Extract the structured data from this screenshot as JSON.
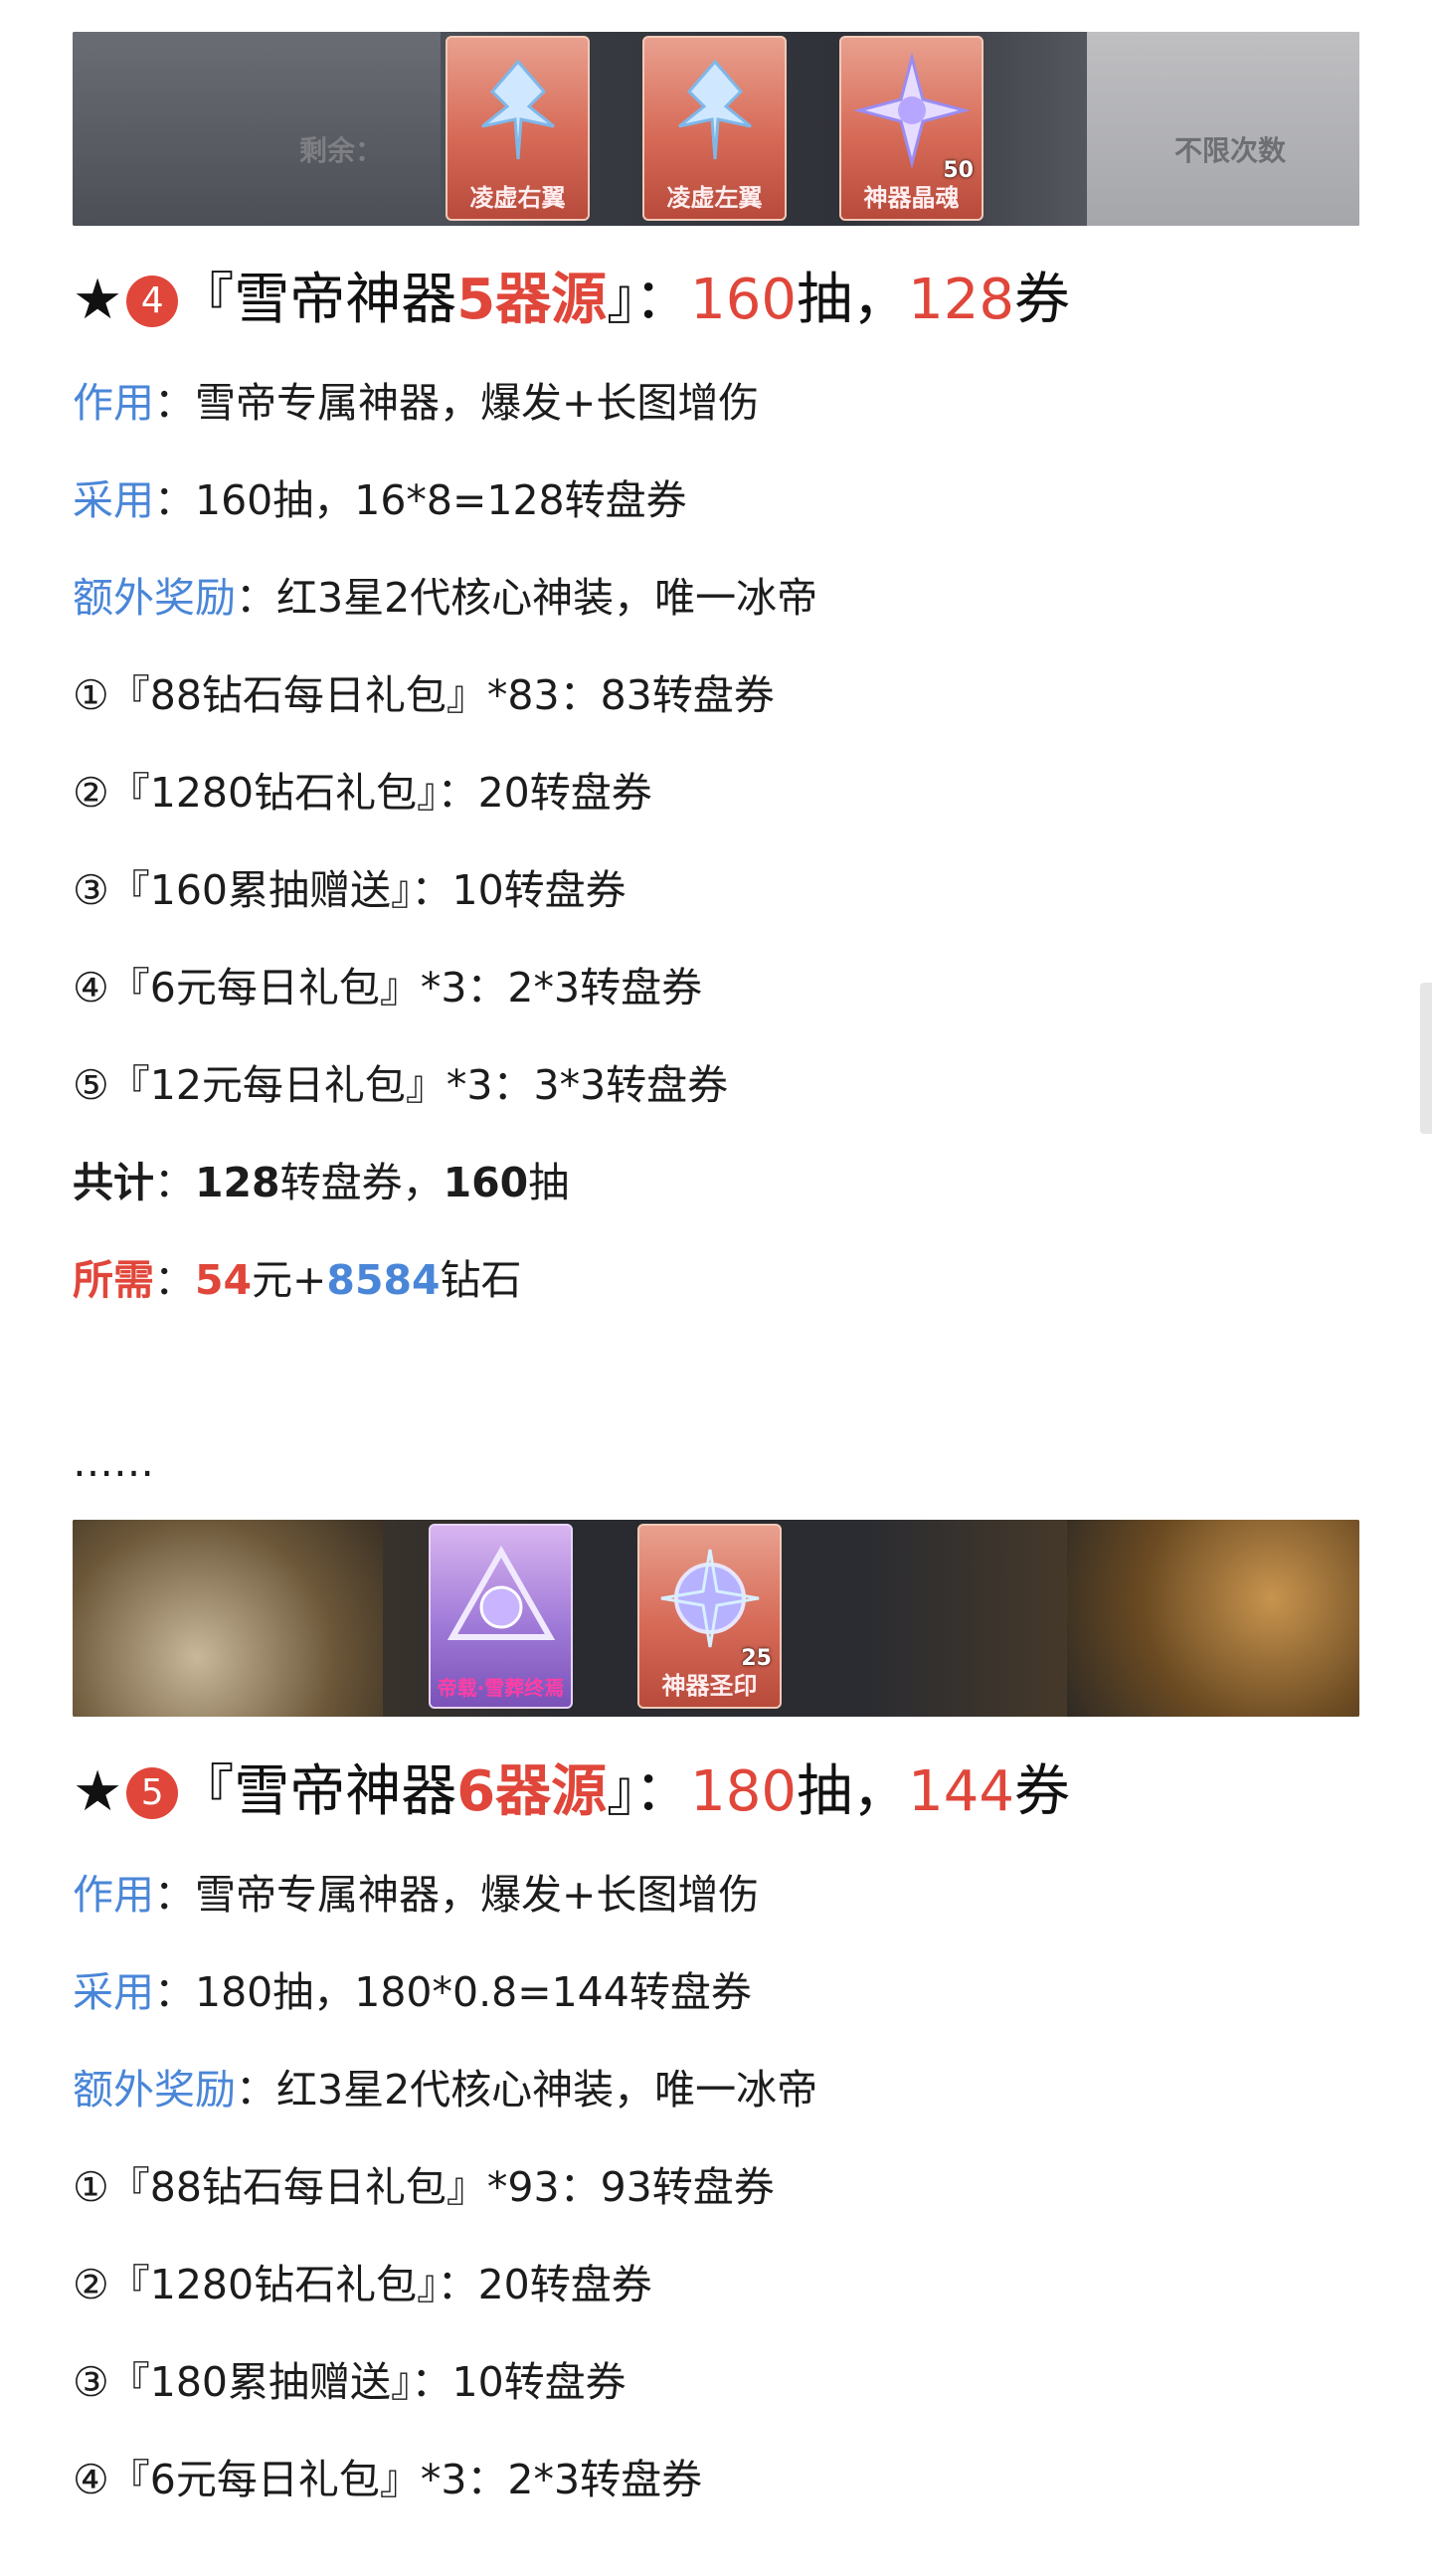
{
  "banner1": {
    "left_label": "剩余：",
    "right_label": "不限次数",
    "items": [
      {
        "label": "凌虚右翼",
        "count": ""
      },
      {
        "label": "凌虚左翼",
        "count": ""
      },
      {
        "label": "神器晶魂",
        "count": "50"
      }
    ]
  },
  "section4": {
    "star": "★",
    "badge": "4",
    "open_bracket": "『雪帝神器",
    "level": "5器源",
    "close_bracket": "』：",
    "draws": "160",
    "draws_unit": "抽，",
    "tickets": "128",
    "tickets_unit": "券",
    "rows": [
      {
        "key": "作用",
        "text": "：雪帝专属神器，爆发+长图增伤"
      },
      {
        "key": "采用",
        "text": "：160抽，16*8=128转盘券"
      },
      {
        "key": "额外奖励",
        "text": "：红3星2代核心神装，唯一冰帝"
      }
    ],
    "list": [
      "①『88钻石每日礼包』*83：83转盘券",
      "②『1280钻石礼包』：20转盘券",
      "③『160累抽赠送』：10转盘券",
      "④『6元每日礼包』*3：2*3转盘券",
      "⑤『12元每日礼包』*3：3*3转盘券"
    ],
    "total_key": "共计",
    "total_sep": "：",
    "total_tickets": "128",
    "total_tickets_unit": "转盘券，",
    "total_draws": "160",
    "total_draws_unit": "抽",
    "need_key": "所需",
    "need_sep": "：",
    "need_yuan": "54",
    "need_yuan_unit": "元+",
    "need_diamond": "8584",
    "need_diamond_unit": "钻石"
  },
  "ellipsis": "……",
  "banner2": {
    "items": [
      {
        "label": "帝载·雪葬终焉",
        "count": ""
      },
      {
        "label": "神器圣印",
        "count": "25"
      }
    ]
  },
  "section5": {
    "star": "★",
    "badge": "5",
    "open_bracket": "『雪帝神器",
    "level": "6器源",
    "close_bracket": "』：",
    "draws": "180",
    "draws_unit": "抽，",
    "tickets": "144",
    "tickets_unit": "券",
    "rows": [
      {
        "key": "作用",
        "text": "：雪帝专属神器，爆发+长图增伤"
      },
      {
        "key": "采用",
        "text": "：180抽，180*0.8=144转盘券"
      },
      {
        "key": "额外奖励",
        "text": "：红3星2代核心神装，唯一冰帝"
      }
    ],
    "list": [
      "①『88钻石每日礼包』*93：93转盘券",
      "②『1280钻石礼包』：20转盘券",
      "③『180累抽赠送』：10转盘券",
      "④『6元每日礼包』*3：2*3转盘券"
    ]
  },
  "colors": {
    "accent_red": "#e0463a",
    "accent_blue": "#4a86d8"
  }
}
